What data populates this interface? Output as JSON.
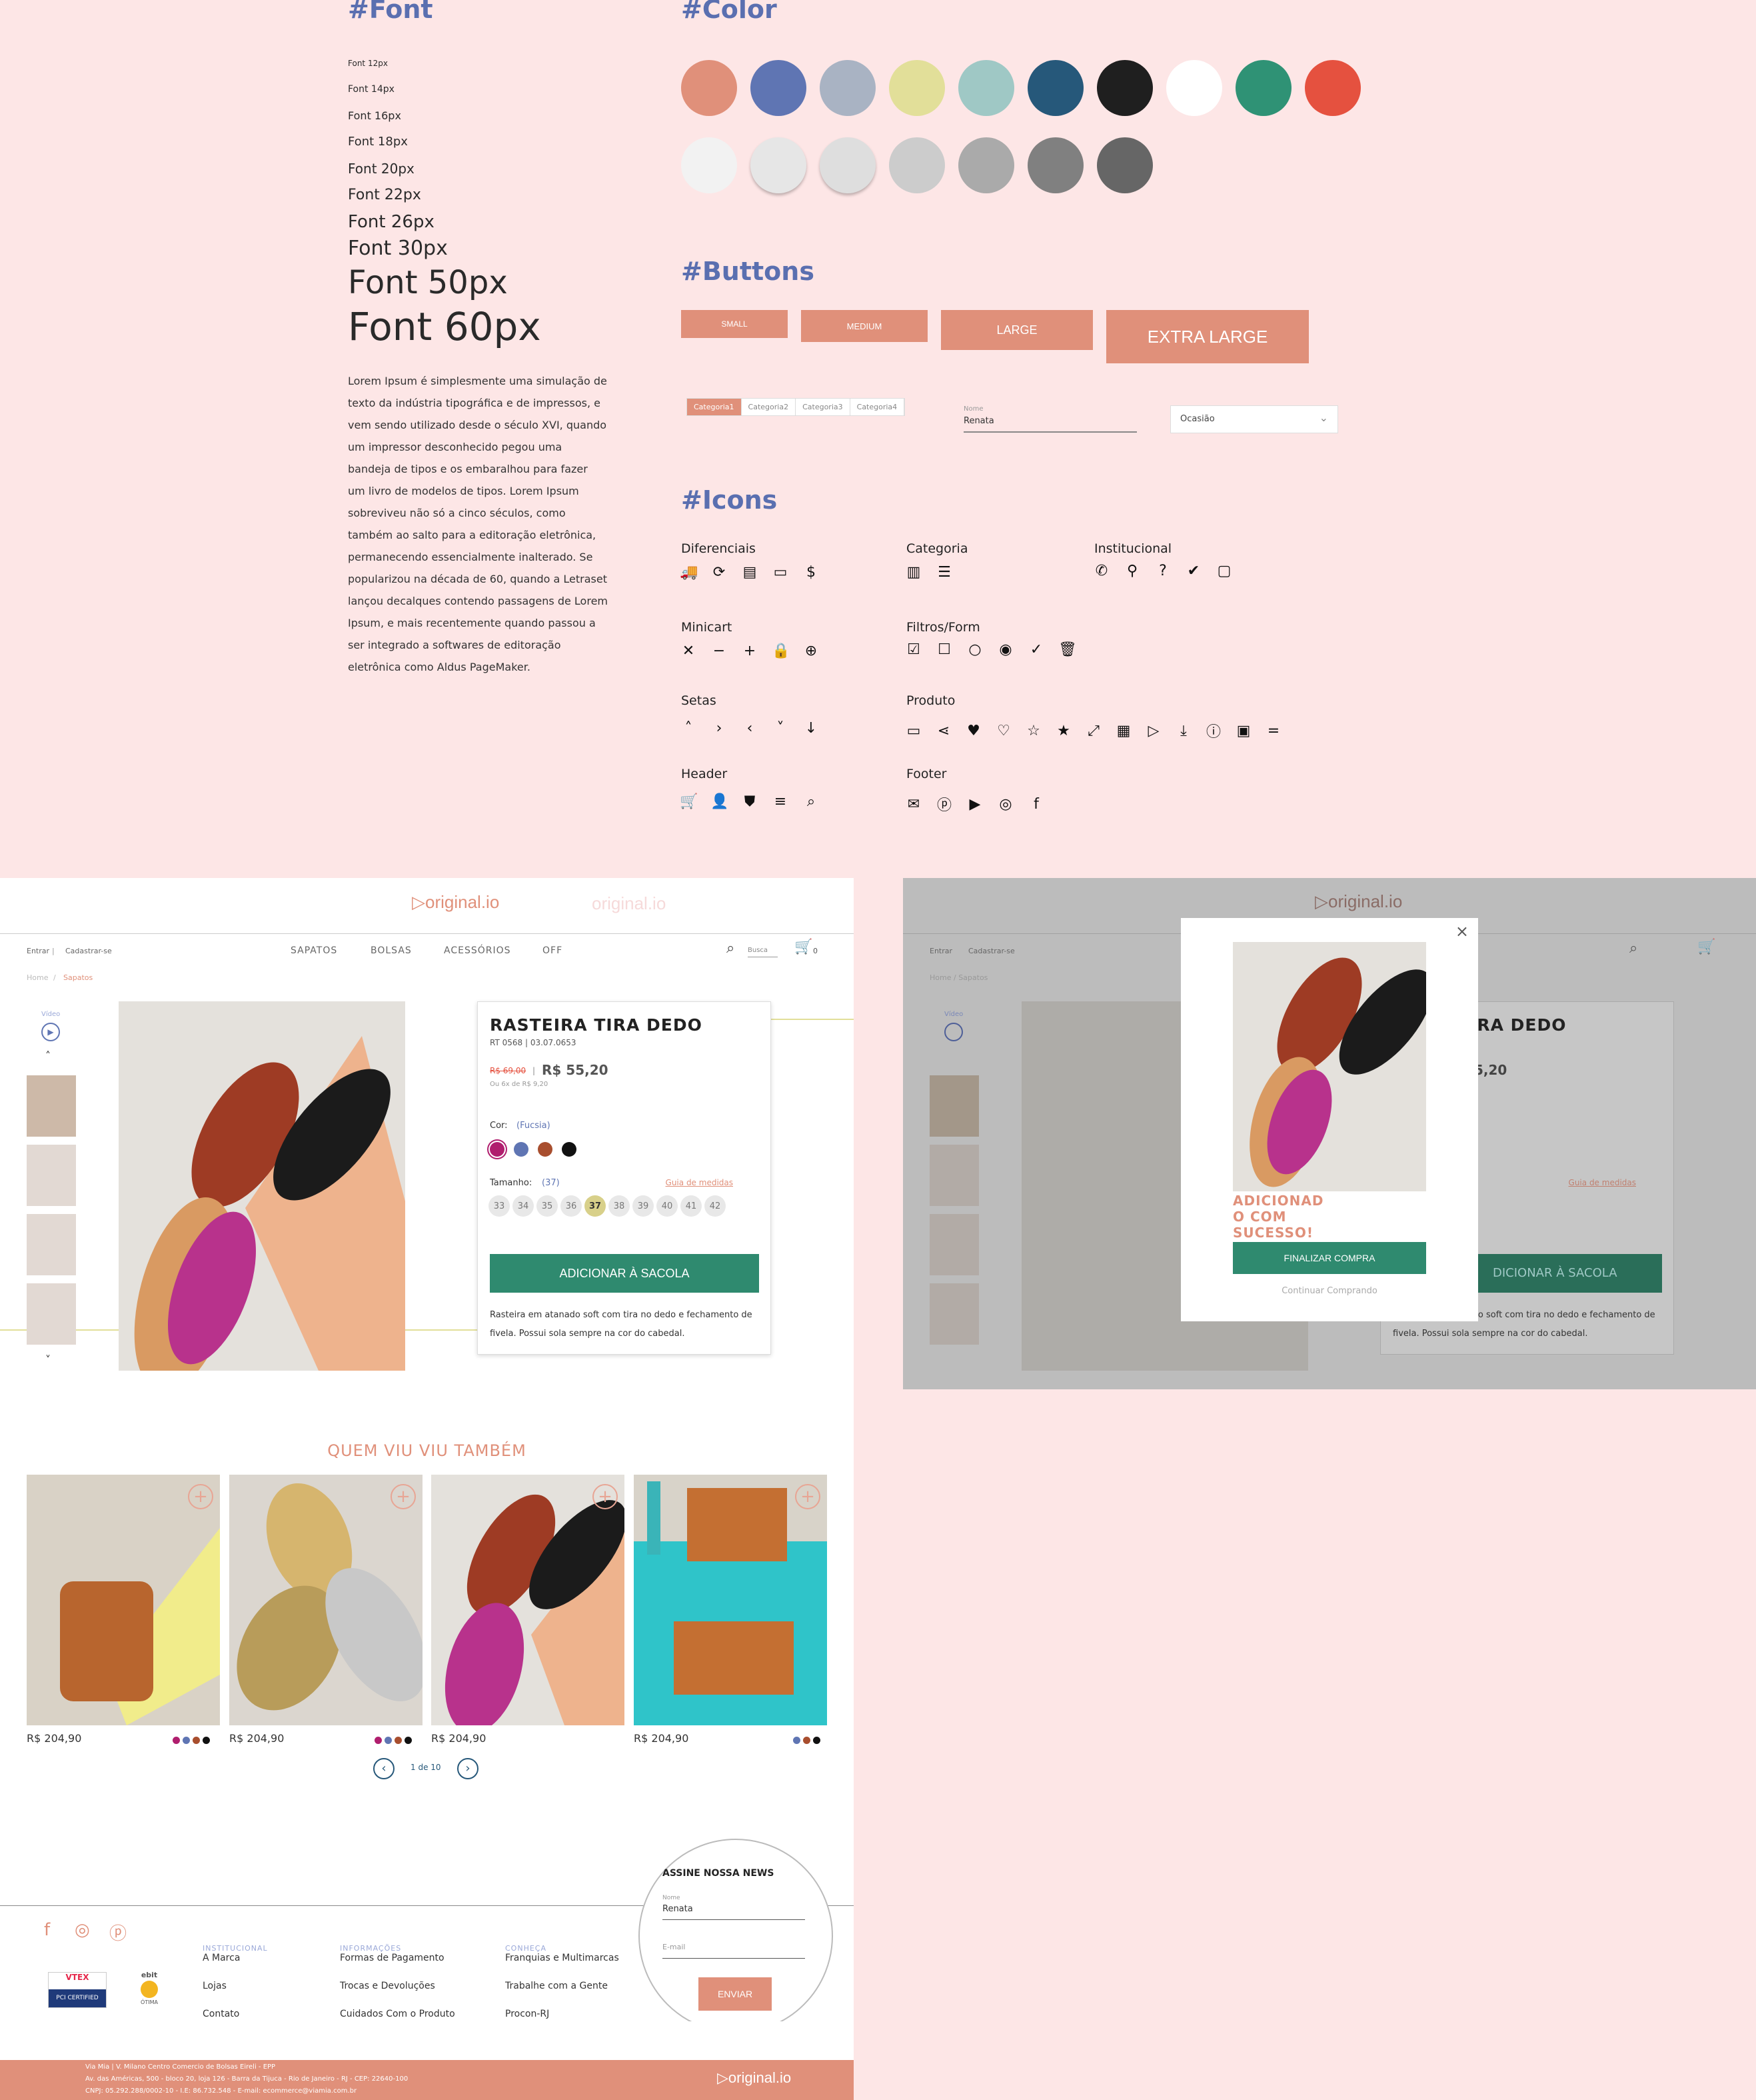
{
  "styleguide": {
    "font_heading": "#Font",
    "font_samples": [
      "Font 12px",
      "Font 14px",
      "Font 16px",
      "Font 18px",
      "Font 20px",
      "Font 22px",
      "Font 26px",
      "Font 30px",
      "Font 50px",
      "Font 60px"
    ],
    "lorem": "Lorem Ipsum é simplesmente uma simulação de texto da indústria tipográfica e de impressos, e vem sendo utilizado desde o século XVI, quando um impressor desconhecido pegou uma bandeja de tipos e os embaralhou para fazer um livro de modelos de tipos. Lorem Ipsum sobreviveu não só a cinco séculos, como também ao salto para a editoração eletrônica, permanecendo essencialmente inalterado. Se popularizou na década de 60, quando a Letraset lançou decalques contendo passagens de Lorem Ipsum, e mais recentemente quando passou a ser integrado a softwares de editoração eletrônica como Aldus PageMaker.",
    "color_heading": "#Color",
    "colors_row1": [
      "#e0907a",
      "#5f75b3",
      "#a9b3c3",
      "#e2df99",
      "#9fc8c5",
      "#26587a",
      "#1f1f1f",
      "#ffffff",
      "#2f9275",
      "#e5513f"
    ],
    "colors_row2": [
      "#f2f2f2",
      "#e6e6e6",
      "#dedede",
      "#cccccc",
      "#aaaaaa",
      "#808080",
      "#666666"
    ],
    "buttons_heading": "#Buttons",
    "btn_small": "SMALL",
    "btn_medium": "MEDIUM",
    "btn_large": "LARGE",
    "btn_xlarge": "EXTRA LARGE",
    "tabs": [
      "Categoria1",
      "Categoria2",
      "Categoria3",
      "Categoria4"
    ],
    "field_label": "Nome",
    "field_value": "Renata",
    "select_value": "Ocasião",
    "icons_heading": "#Icons",
    "icon_groups": {
      "diferenciais": "Diferenciais",
      "categoria": "Categoria",
      "institucional": "Institucional",
      "minicart": "Minicart",
      "filtros": "Filtros/Form",
      "setas": "Setas",
      "produto": "Produto",
      "header": "Header",
      "footer": "Footer"
    }
  },
  "product_page": {
    "logo": "original.io",
    "login": "Entrar",
    "register": "Cadastrar-se",
    "nav": [
      "SAPATOS",
      "BOLSAS",
      "ACESSÓRIOS",
      "OFF"
    ],
    "search_placeholder": "Busca",
    "cart_count": "0",
    "breadcrumb_home": "Home",
    "breadcrumb_current": "Sapatos",
    "video_label": "Vídeo",
    "title": "RASTEIRA TIRA DEDO",
    "ref": "RT 0568 | 03.07.0653",
    "old_price": "R$ 69,00",
    "price": "R$ 55,20",
    "installments": "Ou 6x de  R$ 9,20",
    "color_label": "Cor:",
    "color_value": "(Fucsia)",
    "color_options": [
      "#b01e6e",
      "#5f75b3",
      "#a84e2e",
      "#111111"
    ],
    "size_label": "Tamanho:",
    "size_value": "(37)",
    "size_guide": "Guia de medidas",
    "sizes": [
      "33",
      "34",
      "35",
      "36",
      "37",
      "38",
      "39",
      "40",
      "41",
      "42"
    ],
    "add_to_bag": "ADICIONAR À SACOLA",
    "description": "Rasteira em atanado soft com tira no dedo e fechamento de fivela. Possui sola sempre na cor do cabedal.",
    "related_title": "QUEM VIU VIU TAMBÉM",
    "related_price": "R$ 204,90",
    "pagination": "1 de 10",
    "newsletter_title": "ASSINE NOSSA NEWS",
    "news_name_label": "Nome",
    "news_name_value": "Renata",
    "news_email_placeholder": "E-mail",
    "news_send": "ENVIAR",
    "footer_col1_head": "INSTITUCIONAL",
    "footer_col1": [
      "A Marca",
      "Lojas",
      "Contato"
    ],
    "footer_col2_head": "INFORMAÇÕES",
    "footer_col2": [
      "Formas de Pagamento",
      "Trocas e Devoluções",
      "Cuidados Com o Produto"
    ],
    "footer_col3_head": "CONHEÇA",
    "footer_col3": [
      "Franquias e Multimarcas",
      "Trabalhe com a Gente",
      "Procon-RJ"
    ],
    "vtex_badge": "VTEX",
    "pci_badge": "PCI CERTIFIED",
    "ebit_badge": "ebit",
    "ebit_rating": "ÓTIMA",
    "legal_line1": "Via Mia | V. Milano Centro Comercio de Bolsas Eireli - EPP",
    "legal_line2": "Av. das Américas, 500 - bloco 20, loja 126 - Barra da Tijuca - Rio de Janeiro - RJ - CEP: 22640-100",
    "legal_line3": "CNPJ: 05.292.288/0002-10 - I.E: 86.732.548 - E-mail: ecommerce@viamia.com.br"
  },
  "modal": {
    "title_line1": "ADICIONAD",
    "title_line2": "O COM",
    "title_line3": "SUCESSO!",
    "checkout": "FINALIZAR COMPRA",
    "continue": "Continuar Comprando"
  }
}
